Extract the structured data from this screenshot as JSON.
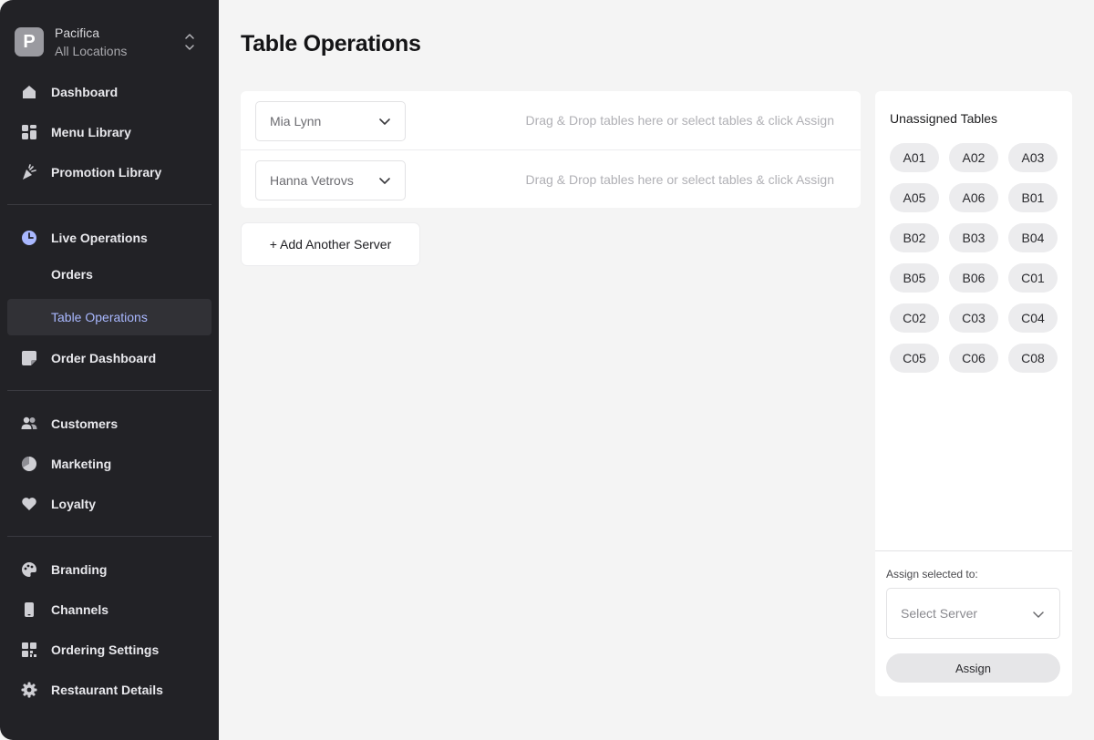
{
  "org": {
    "initial": "P",
    "name": "Pacifica",
    "location": "All Locations"
  },
  "nav": {
    "dashboard": "Dashboard",
    "menu_library": "Menu Library",
    "promotion_library": "Promotion Library",
    "live_operations": "Live Operations",
    "orders": "Orders",
    "table_operations": "Table Operations",
    "order_dashboard": "Order Dashboard",
    "customers": "Customers",
    "marketing": "Marketing",
    "loyalty": "Loyalty",
    "branding": "Branding",
    "channels": "Channels",
    "ordering_settings": "Ordering Settings",
    "restaurant_details": "Restaurant Details"
  },
  "page": {
    "title": "Table Operations"
  },
  "servers": [
    {
      "name": "Mia Lynn",
      "hint": "Drag & Drop tables here or select tables & click Assign"
    },
    {
      "name": "Hanna Vetrovs",
      "hint": "Drag & Drop tables here or select tables & click Assign"
    }
  ],
  "add_server_label": "+ Add Another Server",
  "unassigned": {
    "title": "Unassigned Tables",
    "tables": [
      "A01",
      "A02",
      "A03",
      "A05",
      "A06",
      "B01",
      "B02",
      "B03",
      "B04",
      "B05",
      "B06",
      "C01",
      "C02",
      "C03",
      "C04",
      "C05",
      "C06",
      "C08"
    ],
    "assign_label": "Assign selected to:",
    "select_placeholder": "Select Server",
    "assign_button": "Assign"
  },
  "colors": {
    "sidebar_bg": "#222226",
    "active_accent": "#a9b8ff",
    "page_bg": "#f4f4f4"
  }
}
